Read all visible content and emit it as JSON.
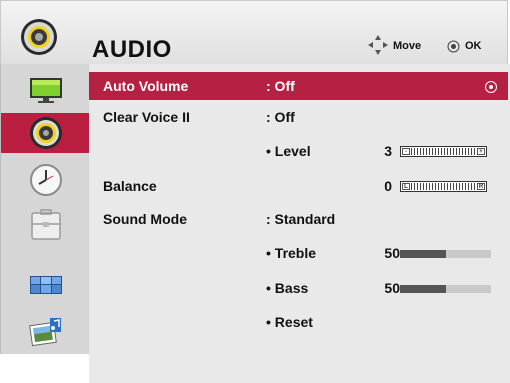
{
  "header": {
    "title": "AUDIO",
    "hint_move": "Move",
    "hint_ok": "OK"
  },
  "strip": {
    "items": [
      {
        "icon": "tv-monitor-icon",
        "selected": false
      },
      {
        "icon": "speaker-icon",
        "selected": true
      },
      {
        "icon": "clock-icon",
        "selected": false
      },
      {
        "icon": "toolbox-icon",
        "selected": false
      },
      {
        "icon": "multi-screen-icon",
        "selected": false
      },
      {
        "icon": "photo-music-icon",
        "selected": false
      }
    ]
  },
  "menu": {
    "auto_volume": {
      "label": "Auto Volume",
      "value": ": Off"
    },
    "clear_voice": {
      "label": "Clear Voice II",
      "value": ": Off"
    },
    "level": {
      "label": "• Level",
      "value": "3",
      "fraction": 0.5,
      "left_cap": "-",
      "right_cap": "+"
    },
    "balance": {
      "label": "Balance",
      "value": "0",
      "fraction": 0.5,
      "left_cap": "L",
      "right_cap": "R"
    },
    "sound_mode": {
      "label": "Sound Mode",
      "value": ": Standard"
    },
    "treble": {
      "label": "• Treble",
      "value": "50",
      "fraction": 0.5
    },
    "bass": {
      "label": "• Bass",
      "value": "50",
      "fraction": 0.5
    },
    "reset": {
      "label": "• Reset"
    }
  },
  "colors": {
    "highlight": "#b52143",
    "strip_selected": "#ba1f42",
    "menu_bg": "#e9e9e9",
    "strip_bg": "#d6d6d6"
  }
}
